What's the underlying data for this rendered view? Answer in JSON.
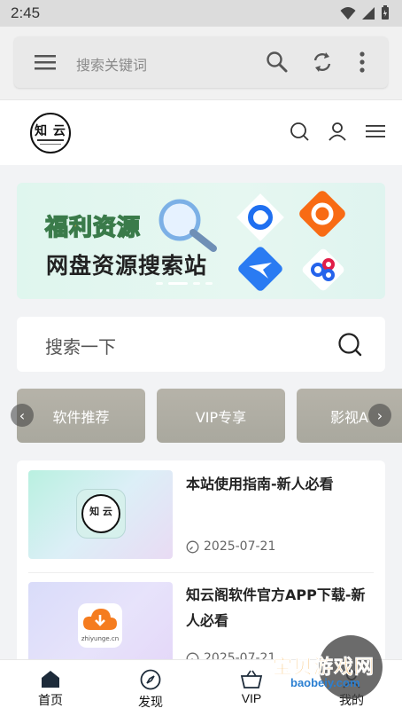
{
  "status_bar": {
    "time": "2:45"
  },
  "browser_toolbar": {
    "search_placeholder": "搜索关键词"
  },
  "site_header": {
    "logo_text": "知 云"
  },
  "banner": {
    "headline": "福利资源",
    "subhead": "网盘资源搜索站"
  },
  "search": {
    "placeholder": "搜索一下"
  },
  "categories": [
    {
      "label": "软件推荐"
    },
    {
      "label": "VIP专享"
    },
    {
      "label": "影视A"
    }
  ],
  "posts": [
    {
      "title": "本站使用指南-新人必看",
      "date": "2025-07-21",
      "thumb_text": "知 云"
    },
    {
      "title": "知云阁软件官方APP下载-新人必看",
      "date": "2025-07-21",
      "thumb_text": "zhiyunge.cn"
    }
  ],
  "bottom_nav": [
    {
      "label": "首页"
    },
    {
      "label": "发现"
    },
    {
      "label": "VIP"
    },
    {
      "label": "我的"
    }
  ],
  "watermark": {
    "text": "宝贝游戏网",
    "url": "baobeiy.com"
  }
}
